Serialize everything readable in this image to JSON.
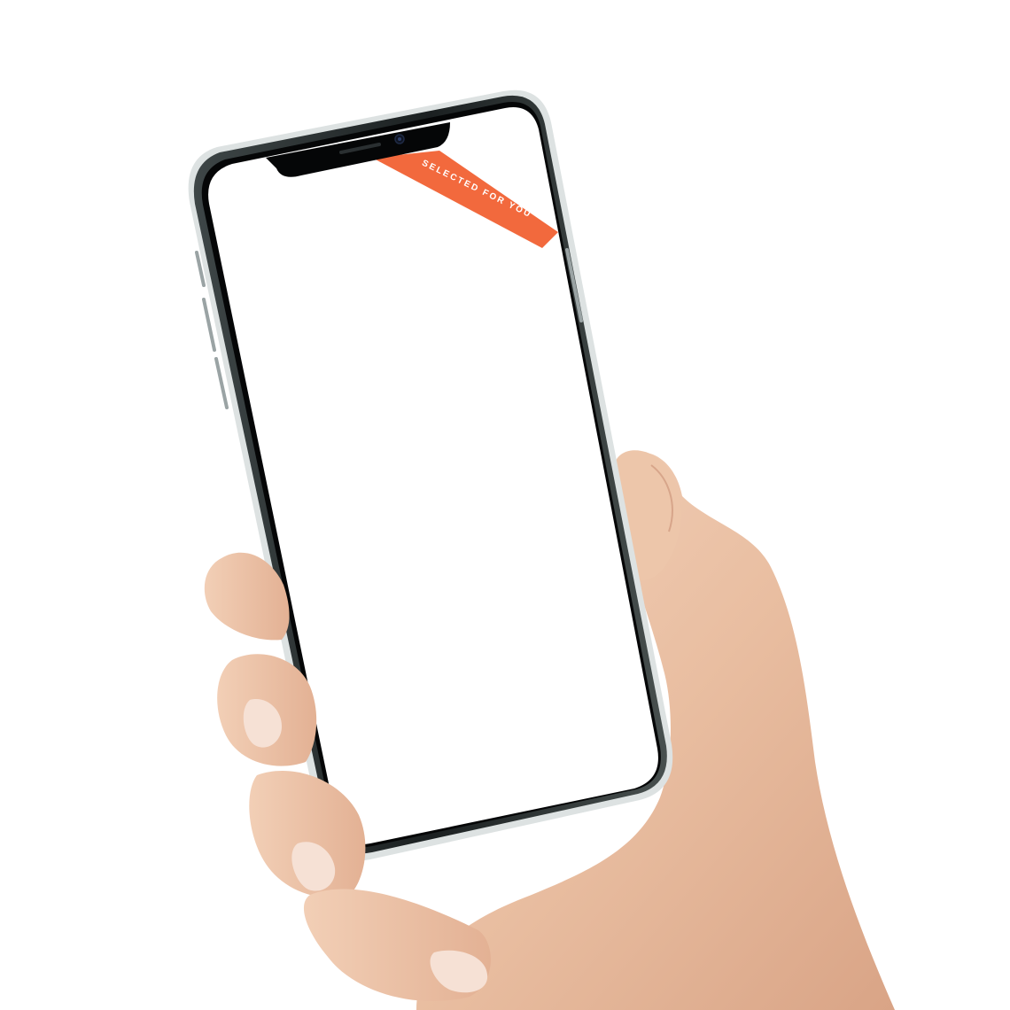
{
  "screen": {
    "ribbon": {
      "label": "SELECTED FOR YOU",
      "color": "#F2693D"
    },
    "background_color": "#FFFFFF"
  },
  "device": {
    "frame_color": "#1E2324",
    "bezel_color": "#050607"
  },
  "hand": {
    "skin_color": "#EAC0A3"
  }
}
